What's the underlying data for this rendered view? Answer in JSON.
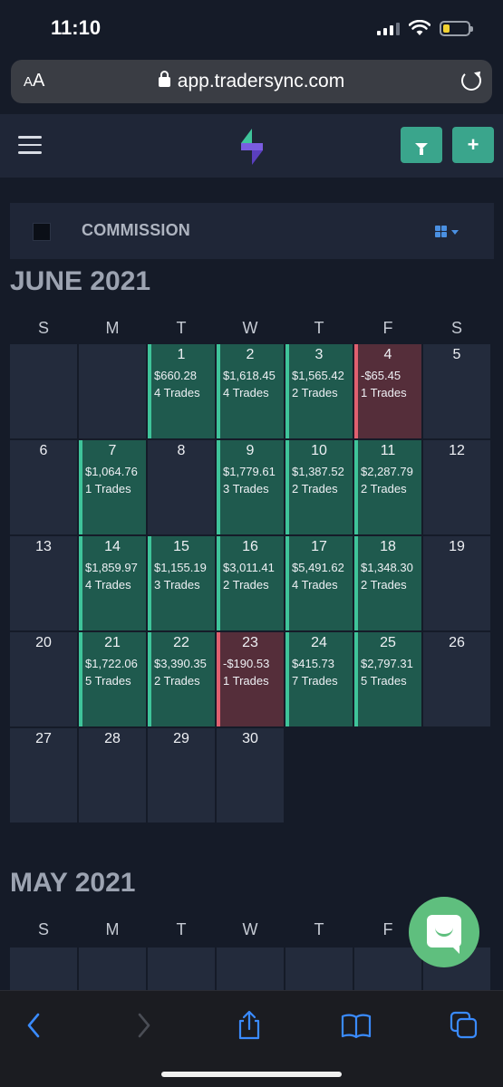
{
  "status_bar": {
    "time": "11:10"
  },
  "browser": {
    "font_size_control": "AA",
    "url": "app.tradersync.com"
  },
  "toolbar": {
    "filter_icon": "funnel-icon",
    "add_label": "+"
  },
  "commission": {
    "label": "COMMISSION"
  },
  "weekdays": [
    "S",
    "M",
    "T",
    "W",
    "T",
    "F",
    "S"
  ],
  "months": [
    {
      "title": "JUNE 2021",
      "weeks": [
        [
          {
            "day": "",
            "status": "empty"
          },
          {
            "day": "",
            "status": "empty"
          },
          {
            "day": "1",
            "amount": "$660.28",
            "trades": "4 Trades",
            "status": "pos"
          },
          {
            "day": "2",
            "amount": "$1,618.45",
            "trades": "4 Trades",
            "status": "pos"
          },
          {
            "day": "3",
            "amount": "$1,565.42",
            "trades": "2 Trades",
            "status": "pos"
          },
          {
            "day": "4",
            "amount": "-$65.45",
            "trades": "1 Trades",
            "status": "neg"
          },
          {
            "day": "5",
            "status": "empty"
          }
        ],
        [
          {
            "day": "6",
            "status": "empty"
          },
          {
            "day": "7",
            "amount": "$1,064.76",
            "trades": "1 Trades",
            "status": "pos"
          },
          {
            "day": "8",
            "status": "empty"
          },
          {
            "day": "9",
            "amount": "$1,779.61",
            "trades": "3 Trades",
            "status": "pos"
          },
          {
            "day": "10",
            "amount": "$1,387.52",
            "trades": "2 Trades",
            "status": "pos"
          },
          {
            "day": "11",
            "amount": "$2,287.79",
            "trades": "2 Trades",
            "status": "pos"
          },
          {
            "day": "12",
            "status": "empty"
          }
        ],
        [
          {
            "day": "13",
            "status": "empty"
          },
          {
            "day": "14",
            "amount": "$1,859.97",
            "trades": "4 Trades",
            "status": "pos"
          },
          {
            "day": "15",
            "amount": "$1,155.19",
            "trades": "3 Trades",
            "status": "pos"
          },
          {
            "day": "16",
            "amount": "$3,011.41",
            "trades": "2 Trades",
            "status": "pos"
          },
          {
            "day": "17",
            "amount": "$5,491.62",
            "trades": "4 Trades",
            "status": "pos"
          },
          {
            "day": "18",
            "amount": "$1,348.30",
            "trades": "2 Trades",
            "status": "pos"
          },
          {
            "day": "19",
            "status": "empty"
          }
        ],
        [
          {
            "day": "20",
            "status": "empty"
          },
          {
            "day": "21",
            "amount": "$1,722.06",
            "trades": "5 Trades",
            "status": "pos"
          },
          {
            "day": "22",
            "amount": "$3,390.35",
            "trades": "2 Trades",
            "status": "pos"
          },
          {
            "day": "23",
            "amount": "-$190.53",
            "trades": "1 Trades",
            "status": "neg"
          },
          {
            "day": "24",
            "amount": "$415.73",
            "trades": "7 Trades",
            "status": "pos"
          },
          {
            "day": "25",
            "amount": "$2,797.31",
            "trades": "5 Trades",
            "status": "pos"
          },
          {
            "day": "26",
            "status": "empty"
          }
        ],
        [
          {
            "day": "27",
            "status": "empty"
          },
          {
            "day": "28",
            "status": "empty"
          },
          {
            "day": "29",
            "status": "empty"
          },
          {
            "day": "30",
            "status": "empty"
          }
        ]
      ]
    },
    {
      "title": "MAY 2021",
      "weeks": [
        [
          {
            "day": "",
            "status": "empty"
          },
          {
            "day": "",
            "status": "empty"
          },
          {
            "day": "",
            "status": "empty"
          },
          {
            "day": "",
            "status": "empty"
          },
          {
            "day": "",
            "status": "empty"
          },
          {
            "day": "",
            "status": "empty"
          },
          {
            "day": "",
            "status": "empty"
          }
        ]
      ]
    }
  ],
  "colors": {
    "accent": "#3aa58c",
    "positive": "#1f5a4e",
    "positive_edge": "#3fc49a",
    "negative": "#552e3a",
    "negative_edge": "#e0606f"
  }
}
